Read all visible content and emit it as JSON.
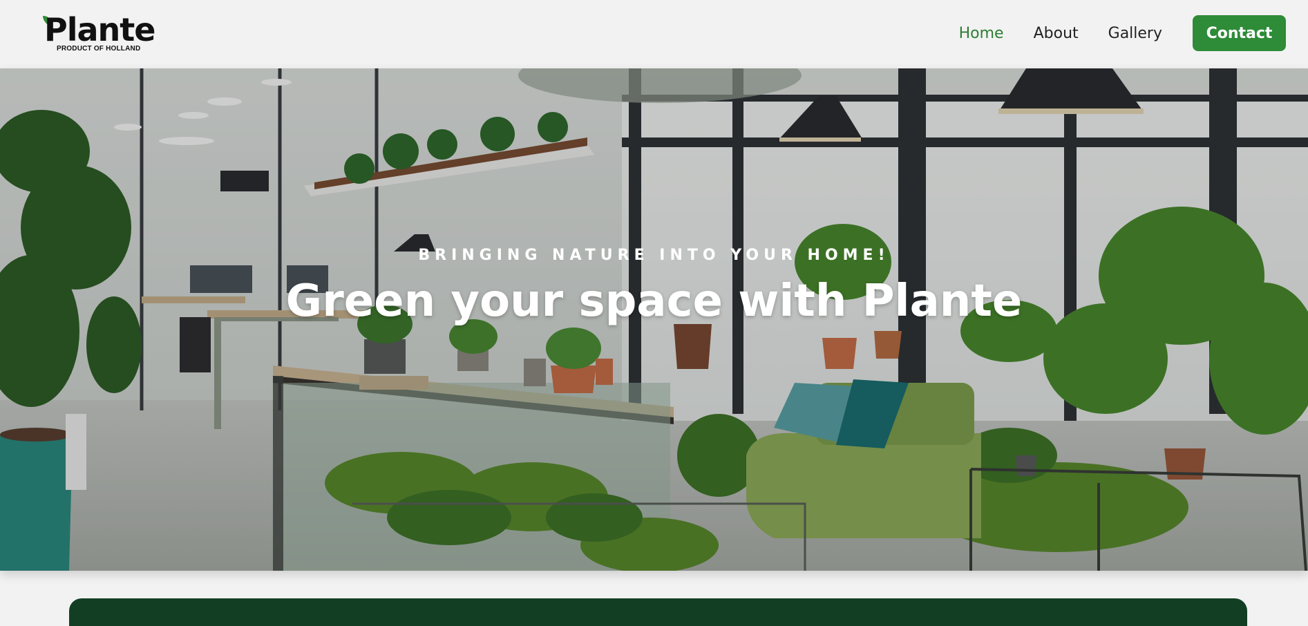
{
  "brand": {
    "name": "Plante",
    "tagline": "PRODUCT OF HOLLAND",
    "colors": {
      "primary": "#2e8b38",
      "dark": "#123f24",
      "active_link": "#2e7d33"
    }
  },
  "nav": {
    "items": [
      {
        "label": "Home",
        "active": true
      },
      {
        "label": "About",
        "active": false
      },
      {
        "label": "Gallery",
        "active": false
      }
    ],
    "contact_label": "Contact"
  },
  "hero": {
    "tagline": "BRINGING NATURE INTO YOUR HOME!",
    "title": "Green your space with Plante"
  }
}
